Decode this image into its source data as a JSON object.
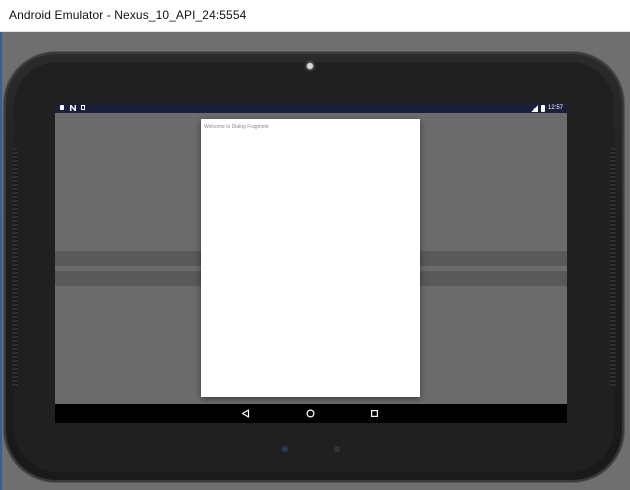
{
  "window": {
    "title": "Android Emulator - Nexus_10_API_24:5554"
  },
  "status_bar": {
    "left_icons": [
      "sim-card-icon",
      "notification-n-icon",
      "storage-icon"
    ],
    "right_icons": [
      "signal-icon",
      "battery-icon"
    ],
    "time": "12:57"
  },
  "dialog": {
    "text": "Welcome to Dialog Fragment"
  },
  "nav_bar": {
    "buttons": [
      "back-icon",
      "home-icon",
      "recent-apps-icon"
    ]
  },
  "colors": {
    "status_bar": "#1a1f3a",
    "dim_overlay": "#6b6b6b",
    "dialog_bg": "#ffffff",
    "nav_bar": "#000000"
  }
}
